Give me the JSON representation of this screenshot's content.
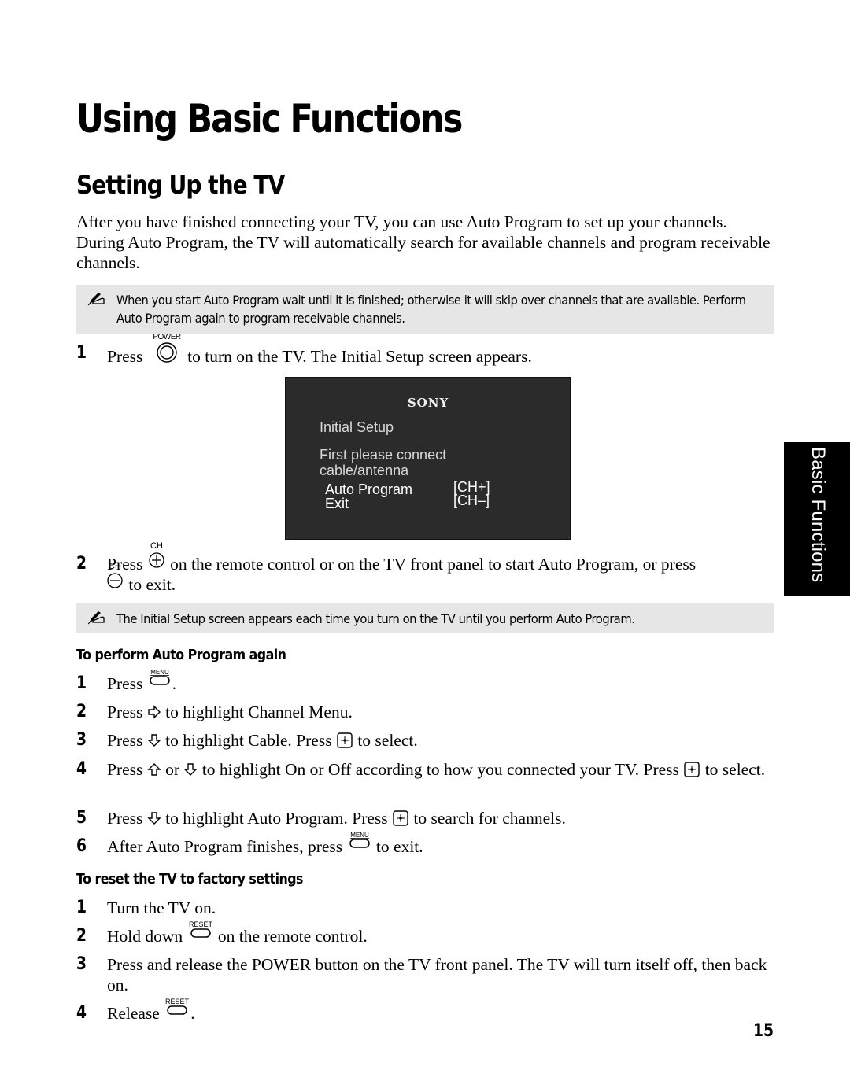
{
  "page": {
    "title": "Using Basic Functions",
    "section_title": "Setting Up the TV",
    "intro": "After you have finished connecting your TV, you can use Auto Program to set up your channels. During Auto Program, the TV will automatically search for available channels and program receivable channels.",
    "side_tab": "Basic Functions",
    "page_number": "15"
  },
  "notes": [
    {
      "icon": "note-pencil-icon",
      "text": "When you start Auto Program wait until it is finished; otherwise it will skip over channels that are available. Perform Auto Program again to program receivable channels."
    },
    {
      "icon": "note-pencil-icon",
      "text": "The Initial Setup screen appears each time you turn on the TV until you perform Auto Program."
    }
  ],
  "setup_steps": [
    {
      "num": "1",
      "pre": "Press",
      "button": "POWER",
      "post": "to turn on the TV. The Initial Setup screen appears."
    },
    {
      "num": "2",
      "pre": "Press",
      "button": "CH",
      "mid": "on the remote control or on the TV front panel to start Auto Program, or press",
      "button2": "CH",
      "post": "to exit."
    }
  ],
  "tv_screen": {
    "logo": "SONY",
    "heading": "Initial Setup",
    "message_line1": "First please connect",
    "message_line2": "cable/antenna",
    "options": [
      {
        "label": "Auto Program",
        "key": "[CH+]"
      },
      {
        "label": "Exit",
        "key": "[CH–]"
      }
    ]
  },
  "auto_program_again": {
    "heading": "To perform Auto Program again",
    "steps": [
      {
        "num": "1",
        "a": "Press",
        "b": "."
      },
      {
        "num": "2",
        "a": "Press",
        "b": "to highlight Channel Menu."
      },
      {
        "num": "3",
        "a": "Press",
        "b": "to highlight Cable. Press",
        "c": "to select."
      },
      {
        "num": "4",
        "a": "Press",
        "or": "or",
        "b": "to highlight On or Off according to how you connected your TV. Press",
        "c": "to select."
      },
      {
        "num": "5",
        "a": "Press",
        "b": "to highlight Auto Program. Press",
        "c": "to search for channels."
      },
      {
        "num": "6",
        "a": "After Auto Program finishes, press",
        "b": "to exit."
      }
    ]
  },
  "factory_reset": {
    "heading": "To reset the TV to factory settings",
    "steps": [
      {
        "num": "1",
        "a": "Turn the TV on."
      },
      {
        "num": "2",
        "a": "Hold down",
        "b": "on the remote control."
      },
      {
        "num": "3",
        "a": "Press and release the POWER button on the TV front panel. The TV will turn itself off, then back on."
      },
      {
        "num": "4",
        "a": "Release",
        "b": "."
      }
    ]
  },
  "button_labels": {
    "power": "POWER",
    "ch": "CH",
    "menu": "MENU",
    "reset": "RESET"
  }
}
